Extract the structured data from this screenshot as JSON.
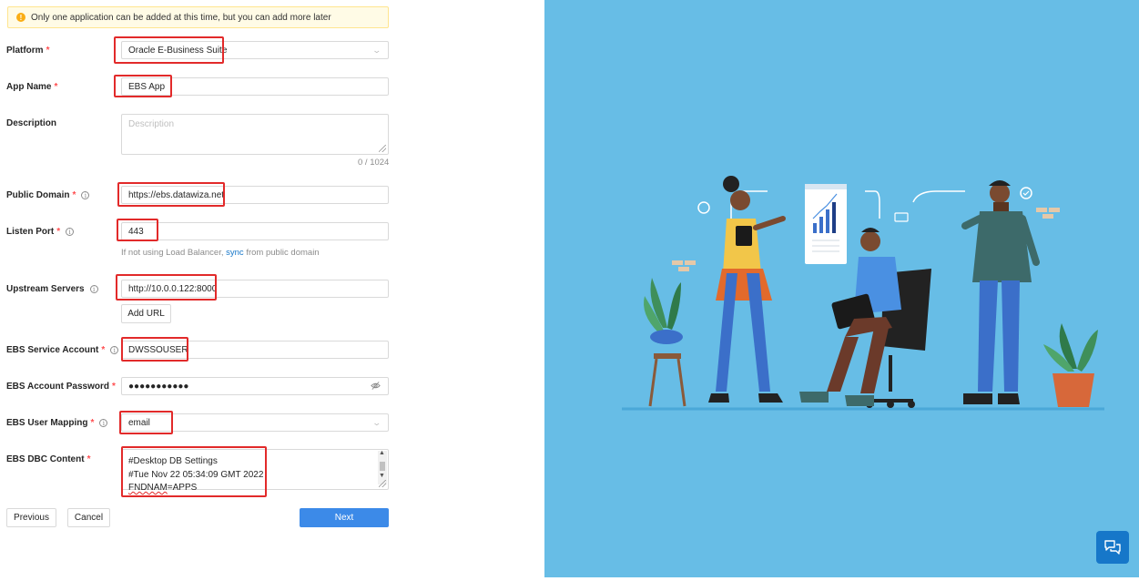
{
  "alert": {
    "text": "Only one application can be added at this time, but you can add more later",
    "icon": "exclamation-icon"
  },
  "form": {
    "platform": {
      "label": "Platform",
      "required": "*",
      "value": "Oracle E-Business Suite"
    },
    "app_name": {
      "label": "App Name",
      "required": "*",
      "value": "EBS App"
    },
    "description": {
      "label": "Description",
      "placeholder": "Description",
      "counter": "0 / 1024"
    },
    "public_domain": {
      "label": "Public Domain",
      "required": "*",
      "value": "https://ebs.datawiza.net"
    },
    "listen_port": {
      "label": "Listen Port",
      "required": "*",
      "value": "443",
      "hint_prefix": "If not using Load Balancer, ",
      "hint_link": "sync",
      "hint_suffix": " from public domain"
    },
    "upstream_servers": {
      "label": "Upstream Servers",
      "value": "http://10.0.0.122:8000",
      "add_url": "Add URL"
    },
    "ebs_service_account": {
      "label": "EBS Service Account",
      "required": "*",
      "value": "DWSSOUSER"
    },
    "ebs_account_password": {
      "label": "EBS Account Password",
      "required": "*",
      "value": "●●●●●●●●●●●"
    },
    "ebs_user_mapping": {
      "label": "EBS User Mapping",
      "required": "*",
      "value": "email"
    },
    "ebs_dbc_content": {
      "label": "EBS DBC Content",
      "required": "*",
      "line1": "#Desktop DB Settings",
      "line2": "#Tue Nov 22 05:34:09 GMT 2022",
      "line3_word": "FNDNAM",
      "line3_rest": "=APPS"
    }
  },
  "buttons": {
    "previous": "Previous",
    "cancel": "Cancel",
    "next": "Next"
  },
  "colors": {
    "accent": "#3c8ae8",
    "highlight_box": "#e22a2a",
    "illustration_bg": "#67bde6",
    "chat_button": "#1677c9"
  }
}
